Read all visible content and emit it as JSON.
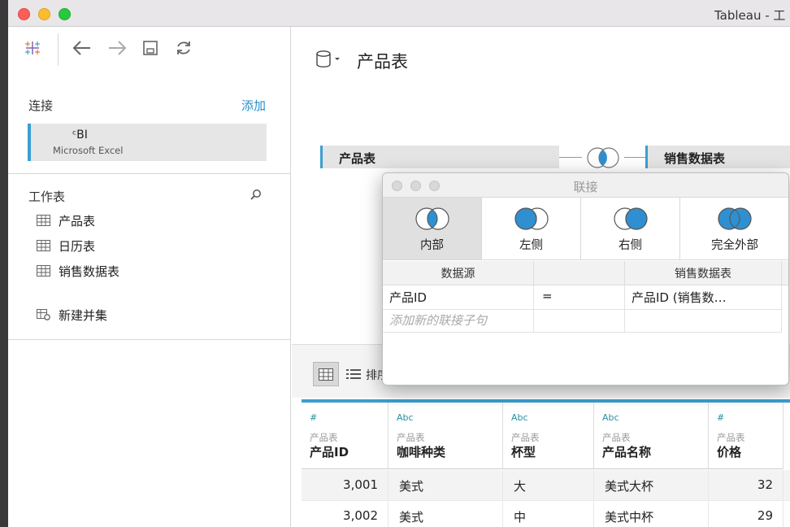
{
  "window": {
    "title": "Tableau - 工"
  },
  "toolbar": {
    "logo_icon": "tableau-logo-icon",
    "back_icon": "arrow-left-icon",
    "forward_icon": "arrow-right-icon",
    "save_icon": "save-icon",
    "refresh_icon": "refresh-icon"
  },
  "connections": {
    "title": "连接",
    "add_label": "添加",
    "items": [
      {
        "name": "ᶜBI",
        "type": "Microsoft Excel"
      }
    ]
  },
  "sheets": {
    "title": "工作表",
    "search_icon": "search-icon",
    "items": [
      {
        "label": "产品表"
      },
      {
        "label": "日历表"
      },
      {
        "label": "销售数据表"
      }
    ],
    "new_union_label": "新建并集"
  },
  "datasource": {
    "name": "产品表"
  },
  "canvas": {
    "left_table": "产品表",
    "right_table": "销售数据表",
    "join_icon": "inner-join-icon"
  },
  "join_dialog": {
    "title": "联接",
    "join_types": [
      {
        "label": "内部",
        "selected": true
      },
      {
        "label": "左侧",
        "selected": false
      },
      {
        "label": "右侧",
        "selected": false
      },
      {
        "label": "完全外部",
        "selected": false
      }
    ],
    "headers": {
      "left": "数据源",
      "middle": "",
      "right": "销售数据表"
    },
    "clauses": [
      {
        "left": "产品ID",
        "op": "=",
        "right": "产品ID (销售数…"
      }
    ],
    "add_clause_placeholder": "添加新的联接子句"
  },
  "grid_toolbar": {
    "sort_label": "排序"
  },
  "grid": {
    "columns": [
      {
        "type": "#",
        "source": "产品表",
        "name": "产品ID"
      },
      {
        "type": "Abc",
        "source": "产品表",
        "name": "咖啡种类"
      },
      {
        "type": "Abc",
        "source": "产品表",
        "name": "杯型"
      },
      {
        "type": "Abc",
        "source": "产品表",
        "name": "产品名称"
      },
      {
        "type": "#",
        "source": "产品表",
        "name": "价格"
      }
    ],
    "rows": [
      [
        "3,001",
        "美式",
        "大",
        "美式大杯",
        "32"
      ],
      [
        "3,002",
        "美式",
        "中",
        "美式中杯",
        "29"
      ]
    ]
  },
  "colors": {
    "accent": "#3c9ed0",
    "join_fill": "#2f8fd0",
    "link": "#2a8fc7"
  }
}
